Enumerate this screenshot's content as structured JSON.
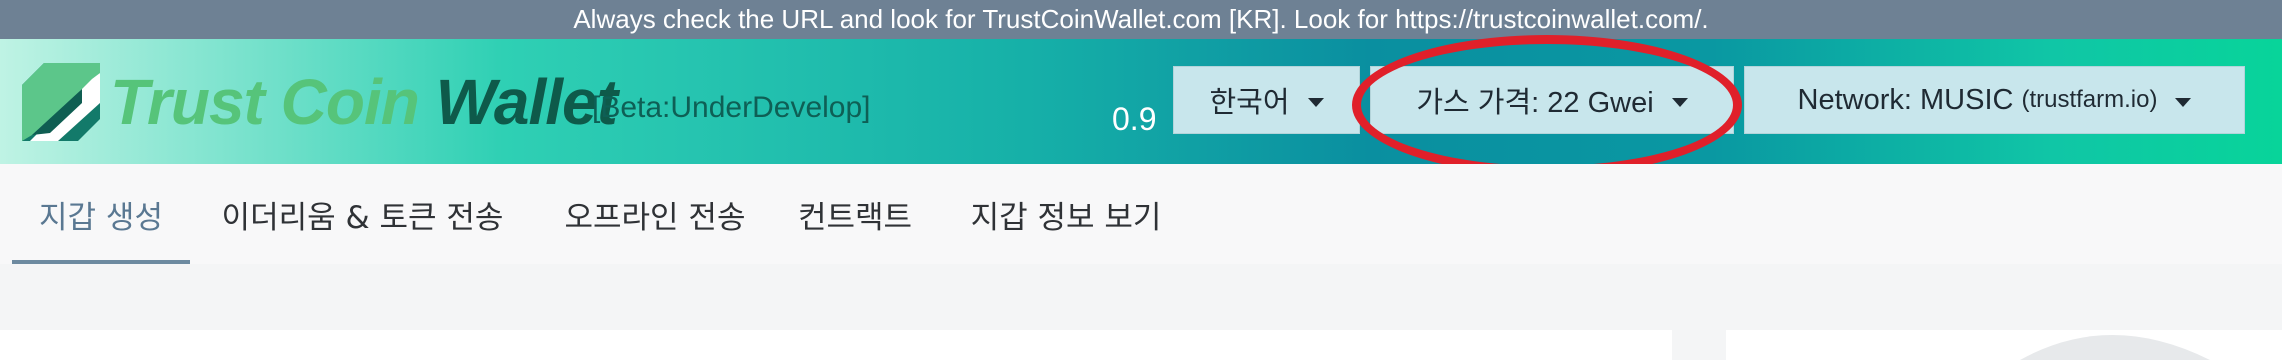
{
  "banner": {
    "text": "Always check the URL and look for TrustCoinWallet.com [KR]. Look for https://trustcoinwallet.com/."
  },
  "header": {
    "logo": {
      "word1": "Trust",
      "word2": "Coin",
      "word3": "Wallet"
    },
    "beta": "[Beta:UnderDevelop]",
    "version": "0.9",
    "language_dropdown": {
      "label": "한국어"
    },
    "gas_dropdown": {
      "label": "가스 가격: 22 Gwei"
    },
    "network_dropdown": {
      "label": "Network: MUSIC",
      "sub": "(trustfarm.io)"
    }
  },
  "nav": {
    "tabs": [
      {
        "label": "지갑 생성",
        "active": true
      },
      {
        "label": "이더리움 & 토큰 전송"
      },
      {
        "label": "오프라인 전송"
      },
      {
        "label": "컨트랙트"
      },
      {
        "label": "지갑 정보 보기"
      }
    ]
  },
  "colors": {
    "banner_bg": "#6e8194",
    "highlight_ellipse": "#e0202a",
    "dropdown_bg": "#c8e6ec",
    "active_tab": "#5a7892"
  }
}
